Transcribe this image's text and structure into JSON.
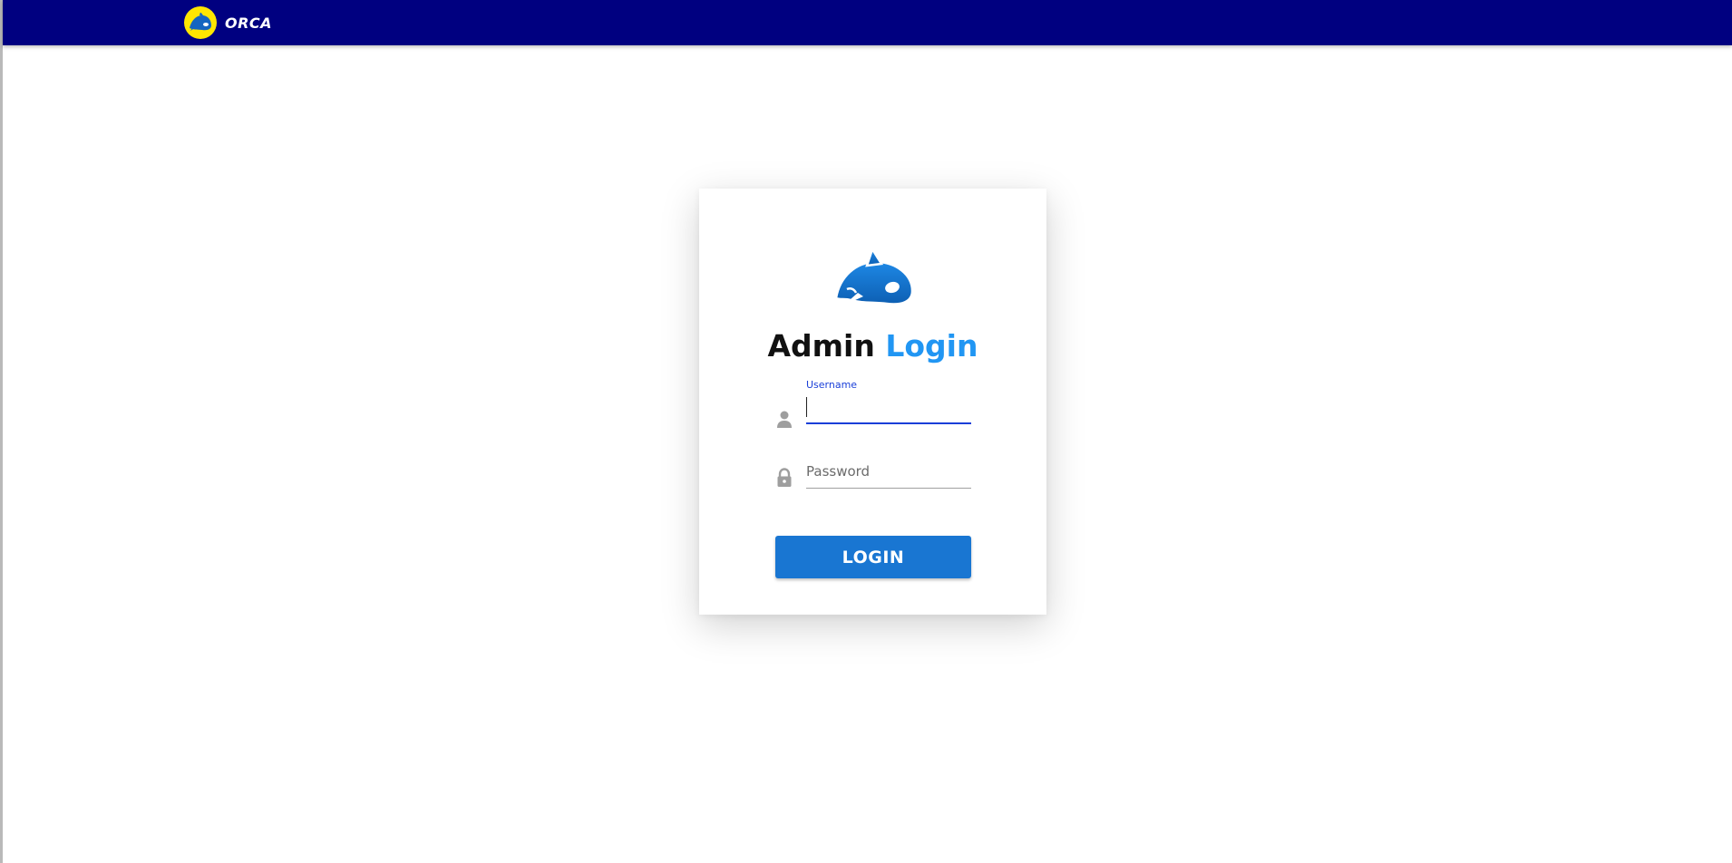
{
  "colors": {
    "nav_bg": "#000080",
    "brand_badge": "#ffe600",
    "primary": "#1976d2",
    "title_accent": "#2196f3",
    "focus": "#1a3fd8"
  },
  "navbar": {
    "brand_text": "ORCA",
    "logo_icon": "orca-whale-icon"
  },
  "login": {
    "logo_icon": "orca-whale-icon",
    "title_primary": "Admin",
    "title_accent": "Login",
    "username": {
      "label": "Username",
      "value": "",
      "icon": "user-icon"
    },
    "password": {
      "placeholder": "Password",
      "value": "",
      "icon": "lock-icon"
    },
    "submit_label": "LOGIN"
  }
}
